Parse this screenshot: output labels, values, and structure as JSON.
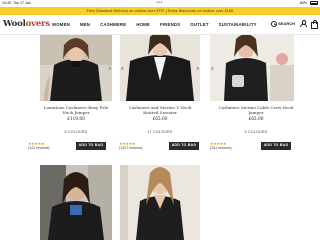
{
  "status_bar": {
    "time": "10:49",
    "date": "Tue 17 Jan",
    "dots": "•••",
    "battery": "80%"
  },
  "promo": {
    "text": "Free Standard Delivery on orders over £70* | Extra Discounts on orders over £150"
  },
  "header": {
    "logo_main": "Wool",
    "logo_accent": "overs",
    "menu": [
      "WOMEN",
      "MEN",
      "CASHMERE",
      "HOME",
      "FRIENDS",
      "OUTLET",
      "SUSTAINABILITY"
    ],
    "search_label": "SEARCH"
  },
  "products": [
    {
      "name_line1": "Luxurious Cashmere Boxy Polo",
      "name_line2": "Neck Jumper",
      "price": "£119.00",
      "colours": "8 COLOURS",
      "stars": "★★★★★",
      "reviews": "(122 reviews)",
      "button": "ADD TO BAG"
    },
    {
      "name_line1": "Cashmere and Merino V Neck",
      "name_line2": "Knitted Sweater",
      "price": "£65.00",
      "colours": "17 COLOURS",
      "stars": "★★★★★",
      "reviews": "(1327 reviews)",
      "button": "ADD TO BAG"
    },
    {
      "name_line1": "Cashmere Merino Cable Crew Neck",
      "name_line2": "Jumper",
      "price": "£65.00",
      "colours": "9 COLOURS",
      "stars": "★★★★★",
      "reviews": "(251 reviews)",
      "button": "ADD TO BAG"
    }
  ],
  "colors": {
    "accent": "#f6d02a",
    "button": "#2b2b2b",
    "stars": "#e2a200"
  },
  "icons": [
    "search-icon",
    "account-icon",
    "bag-icon",
    "chevron-left-icon",
    "chevron-right-icon"
  ]
}
